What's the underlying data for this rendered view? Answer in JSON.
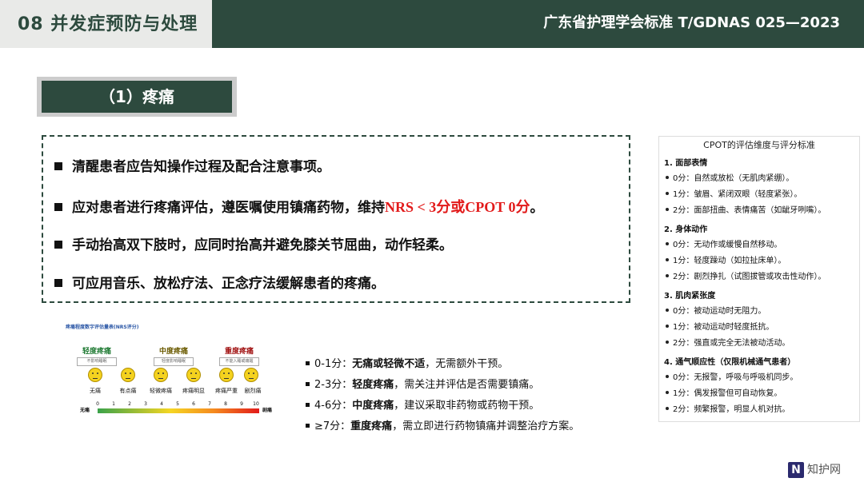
{
  "header": {
    "title": "08  并发症预防与处理",
    "standard": "广东省护理学会标准   T/GDNAS 025—2023"
  },
  "section": {
    "title": "（1）疼痛"
  },
  "bullets": {
    "b1": "清醒患者应告知操作过程及配合注意事项。",
    "b2_pre": "应对患者进行疼痛评估，遵医嘱使用镇痛药物，维持",
    "b2_hl": "NRS < 3分或CPOT 0分",
    "b2_post": "。",
    "b3": "手动抬高双下肢时，应同时抬高并避免膝关节屈曲，动作轻柔。",
    "b4": "可应用音乐、放松疗法、正念疗法缓解患者的疼痛。"
  },
  "scale": {
    "title": "疼痛程度数字评估量表(NRS评分)",
    "categories": {
      "mild": "轻度疼痛",
      "moderate": "中度疼痛",
      "severe": "重度疼痛"
    },
    "category_subs": {
      "mild": "不影响睡眠",
      "moderate": "轻度影响睡眠",
      "severe": "不能入睡或痛醒"
    },
    "faces": {
      "f1": "无痛",
      "f2": "有点痛",
      "f3": "轻微疼痛",
      "f4": "疼痛明显",
      "f5": "疼痛严重",
      "f6": "剧烈痛"
    },
    "bar": {
      "left": "无痛",
      "right": "剧痛"
    },
    "ticks": {
      "t0": "0",
      "t1": "1",
      "t2": "2",
      "t3": "3",
      "t4": "4",
      "t5": "5",
      "t6": "6",
      "t7": "7",
      "t8": "8",
      "t9": "9",
      "t10": "10"
    }
  },
  "levels": {
    "l1_k": "0-1分：",
    "l1_b": "无痛或轻微不适",
    "l1_r": "，无需额外干预。",
    "l2_k": "2-3分：",
    "l2_b": "轻度疼痛",
    "l2_r": "，需关注并评估是否需要镇痛。",
    "l3_k": "4-6分：",
    "l3_b": "中度疼痛",
    "l3_r": "，建议采取非药物或药物干预。",
    "l4_k": "≥7分：",
    "l4_b": "重度疼痛",
    "l4_r": "，需立即进行药物镇痛并调整治疗方案。"
  },
  "cpot": {
    "title": "CPOT的评估维度与评分标准",
    "g1": "1. 面部表情",
    "g1_0": "0分：自然或放松（无肌肉紧绷）。",
    "g1_1": "1分：皱眉、紧闭双眼（轻度紧张）。",
    "g1_2": "2分：面部扭曲、表情痛苦（如龇牙咧嘴）。",
    "g2": "2. 身体动作",
    "g2_0": "0分：无动作或缓慢自然移动。",
    "g2_1": "1分：轻度躁动（如拉扯床单）。",
    "g2_2": "2分：剧烈挣扎（试图拔管或攻击性动作）。",
    "g3": "3. 肌肉紧张度",
    "g3_0": "0分：被动运动时无阻力。",
    "g3_1": "1分：被动运动时轻度抵抗。",
    "g3_2": "2分：强直或完全无法被动活动。",
    "g4": "4. 通气顺应性（仅限机械通气患者）",
    "g4_0": "0分：无报警，呼吸与呼吸机同步。",
    "g4_1": "1分：偶发报警但可自动恢复。",
    "g4_2": "2分：频繁报警，明显人机对抗。"
  },
  "logo": {
    "mark": "N",
    "text": "知护网"
  }
}
